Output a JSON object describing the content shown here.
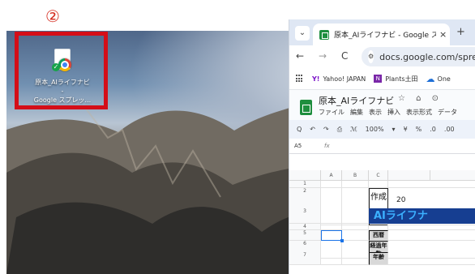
{
  "annotation": {
    "number": "②",
    "color": "#d42a1e"
  },
  "desktop": {
    "shortcut": {
      "label": "原本_AIライフナビ -\nGoogle スプレッ...",
      "icon": "chrome-shortcut-icon"
    },
    "selection_color": "#d40e18"
  },
  "browser": {
    "tab": {
      "title": "原本_AIライフナビ - Google スプレ",
      "close": "×",
      "new_tab": "+"
    },
    "tab_list": "⌄",
    "navigation": {
      "back": "←",
      "forward": "→",
      "reload": "C"
    },
    "address": {
      "site_info": "⚙",
      "url": "docs.google.com/spreads"
    },
    "bookmarks": [
      {
        "label": "Yahoo! JAPAN",
        "icon": "Y!"
      },
      {
        "label": "Plants土田",
        "icon": "N"
      },
      {
        "label": "One",
        "icon": "☁"
      }
    ]
  },
  "sheets": {
    "document_title": "原本_AIライフナビ",
    "title_icons": "☆ ⌂ ⊙",
    "menu": [
      "ファイル",
      "編集",
      "表示",
      "挿入",
      "表示形式",
      "データ"
    ],
    "toolbar": [
      "Q",
      "↶",
      "↷",
      "⎙",
      "ℳ",
      "100%",
      "▾",
      "¥",
      "%",
      ".0",
      ".00"
    ],
    "name_box": "A5",
    "formula_symbol": "fx",
    "columns": [
      "",
      "A",
      "B",
      "C",
      "",
      ""
    ],
    "rows": {
      "r1": "1",
      "r2": "2",
      "r3": "3",
      "r4": "4",
      "r5": "5",
      "r6": "6",
      "r7": "7"
    },
    "cells": {
      "date_label": "作成日",
      "date_value": "20",
      "banner": "AIライフナ",
      "western_year": "西暦",
      "elapsed_years": "経過年数",
      "age": "年齢"
    },
    "accent": "#1a73e8",
    "banner_color": "#163e91"
  }
}
